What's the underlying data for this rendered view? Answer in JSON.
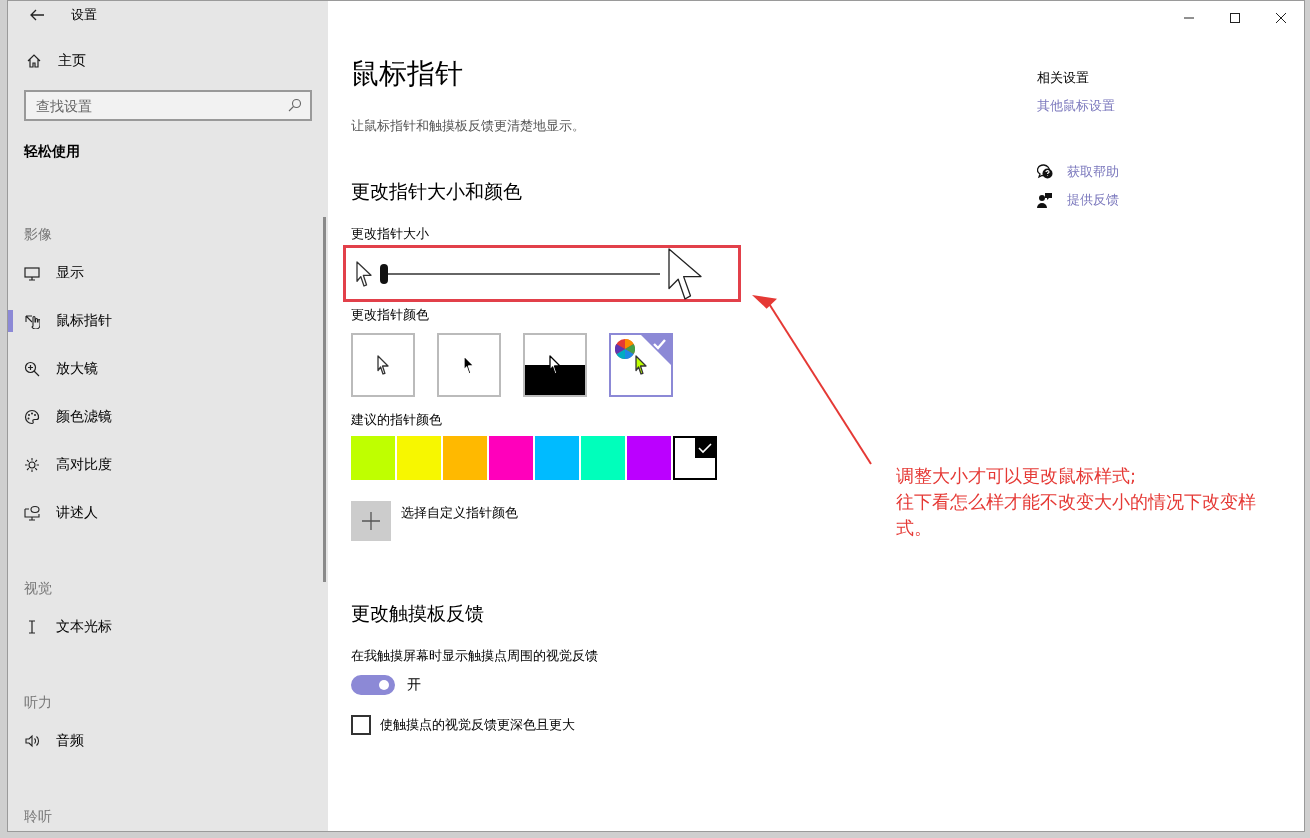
{
  "window": {
    "title": "设置"
  },
  "sidebar": {
    "home": "主页",
    "search": {
      "placeholder": "查找设置"
    },
    "section": "轻松使用",
    "items": [
      {
        "kind": "heading",
        "label": "影像"
      },
      {
        "kind": "item",
        "label": "显示",
        "selected": false
      },
      {
        "kind": "item",
        "label": "鼠标指针",
        "selected": true
      },
      {
        "kind": "item",
        "label": "放大镜",
        "selected": false
      },
      {
        "kind": "item",
        "label": "颜色滤镜",
        "selected": false
      },
      {
        "kind": "item",
        "label": "高对比度",
        "selected": false
      },
      {
        "kind": "item",
        "label": "讲述人",
        "selected": false
      },
      {
        "kind": "heading",
        "label": "视觉"
      },
      {
        "kind": "item",
        "label": "文本光标",
        "selected": false
      },
      {
        "kind": "heading",
        "label": "听力"
      },
      {
        "kind": "item",
        "label": "音频",
        "selected": false
      },
      {
        "kind": "heading",
        "label": "聆听"
      }
    ]
  },
  "page": {
    "title": "鼠标指针",
    "description": "让鼠标指针和触摸板反馈更清楚地显示。"
  },
  "pointer": {
    "heading": "更改指针大小和颜色",
    "size_label": "更改指针大小",
    "size_slider": {
      "level": 0
    },
    "color_label": "更改指针颜色",
    "color_options": [
      {
        "kind": "white",
        "selected": false
      },
      {
        "kind": "black",
        "selected": false
      },
      {
        "kind": "inverted",
        "selected": false
      },
      {
        "kind": "custom",
        "selected": true
      }
    ],
    "suggested_label": "建议的指针颜色",
    "suggested_colors": [
      {
        "color": "#bfff00",
        "selected": false
      },
      {
        "color": "#f7f700",
        "selected": false
      },
      {
        "color": "#ffb900",
        "selected": false
      },
      {
        "color": "#ff00bb",
        "selected": false
      },
      {
        "color": "#00bbff",
        "selected": false
      },
      {
        "color": "#00ffbb",
        "selected": false
      },
      {
        "color": "#bb00ff",
        "selected": false
      },
      {
        "color": "#ffffff",
        "selected": true
      }
    ],
    "custom_color_button": "选择自定义指针颜色"
  },
  "touch": {
    "heading": "更改触摸板反馈",
    "toggle_label": "在我触摸屏幕时显示触摸点周围的视觉反馈",
    "toggle": {
      "on": true,
      "state_text": "开"
    },
    "checkbox": {
      "label": "使触摸点的视觉反馈更深色且更大",
      "checked": false
    }
  },
  "related": {
    "heading": "相关设置",
    "links": [
      "其他鼠标设置"
    ],
    "help": [
      "获取帮助",
      "提供反馈"
    ]
  },
  "annotation": {
    "lines": [
      "调整大小才可以更改鼠标样式;",
      "往下看怎么样才能不改变大小的情况下改变样式。"
    ]
  }
}
